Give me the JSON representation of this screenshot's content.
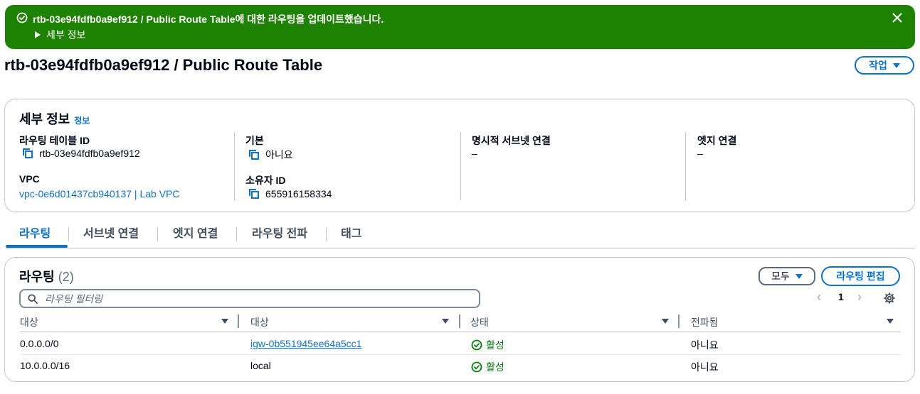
{
  "flash": {
    "route_table_ref": "rtb-03e94fdfb0a9ef912 / Public Route Table",
    "message_suffix": "에 대한 라우팅을 업데이트했습니다.",
    "details_label": "세부 정보"
  },
  "page": {
    "title": "rtb-03e94fdfb0a9ef912 / Public Route Table",
    "actions_label": "작업"
  },
  "details": {
    "heading": "세부 정보",
    "info_link": "정보",
    "route_table_id_label": "라우팅 테이블 ID",
    "route_table_id": "rtb-03e94fdfb0a9ef912",
    "vpc_label": "VPC",
    "vpc_value": "vpc-0e6d01437cb940137 | Lab VPC",
    "main_label": "기본",
    "main_value": "아니요",
    "owner_label": "소유자 ID",
    "owner_value": "655916158334",
    "explicit_subnet_label": "명시적 서브넷 연결",
    "explicit_subnet_value": "–",
    "edge_label": "엣지 연결",
    "edge_value": "–"
  },
  "tabs": [
    {
      "label": "라우팅"
    },
    {
      "label": "서브넷 연결"
    },
    {
      "label": "엣지 연결"
    },
    {
      "label": "라우팅 전파"
    },
    {
      "label": "태그"
    }
  ],
  "routes": {
    "heading": "라우팅",
    "count": "(2)",
    "filter_all_label": "모두",
    "edit_label": "라우팅 편집",
    "search_placeholder": "라우팅 필터링",
    "page_number": "1",
    "columns": [
      "대상",
      "대상",
      "상태",
      "전파됨"
    ],
    "rows": [
      {
        "destination": "0.0.0.0/0",
        "target": "igw-0b551945ee64a5cc1",
        "status": "활성",
        "propagated": "아니요"
      },
      {
        "destination": "10.0.0.0/16",
        "target": "local",
        "status": "활성",
        "propagated": "아니요"
      }
    ]
  },
  "colors": {
    "success": "#1d8102",
    "link": "#0972d3",
    "status_active": "#037f0c"
  }
}
